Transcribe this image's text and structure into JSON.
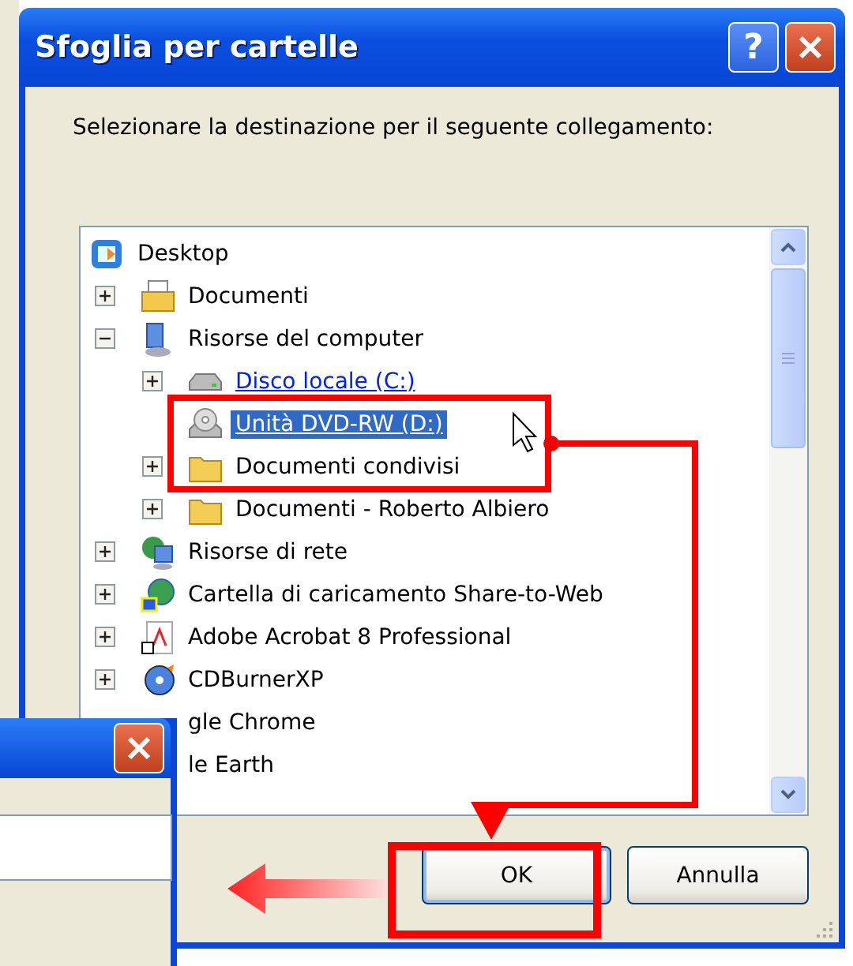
{
  "window": {
    "title": "Sfoglia per cartelle",
    "help_button": "?"
  },
  "prompt": "Selezionare la destinazione per il seguente collegamento:",
  "tree": {
    "label": "Desktop",
    "kind": "desktop",
    "children": [
      {
        "label": "Documenti",
        "kind": "documents",
        "expanded": false,
        "selected": false,
        "hot": false
      },
      {
        "label": "Risorse del computer",
        "kind": "computer",
        "expanded": true,
        "selected": false,
        "hot": false,
        "children": [
          {
            "label": "Disco locale (C:)",
            "kind": "drive",
            "expanded": false,
            "selected": false,
            "hot": true
          },
          {
            "label": "Unità DVD-RW (D:)",
            "kind": "dvd",
            "selected": true,
            "hot": true
          },
          {
            "label": "Documenti condivisi",
            "kind": "folder",
            "expanded": false,
            "selected": false,
            "hot": false
          },
          {
            "label": "Documenti - Roberto Albiero",
            "kind": "folder",
            "expanded": false,
            "selected": false,
            "hot": false
          }
        ]
      },
      {
        "label": "Risorse di rete",
        "kind": "network",
        "expanded": false,
        "selected": false,
        "hot": false
      },
      {
        "label": "Cartella di caricamento Share-to-Web",
        "kind": "globe",
        "expanded": false,
        "selected": false,
        "hot": false
      },
      {
        "label": "Adobe Acrobat 8 Professional",
        "kind": "acrobat",
        "expanded": false,
        "selected": false,
        "hot": false
      },
      {
        "label": "CDBurnerXP",
        "kind": "cdburner",
        "expanded": false,
        "selected": false,
        "hot": false
      },
      {
        "label": "gle Chrome",
        "kind": "covered",
        "selected": false,
        "hot": false
      },
      {
        "label": "le Earth",
        "kind": "covered",
        "selected": false,
        "hot": false
      }
    ]
  },
  "buttons": [
    {
      "label": "OK",
      "default": true
    },
    {
      "label": "Annulla",
      "default": false
    }
  ]
}
